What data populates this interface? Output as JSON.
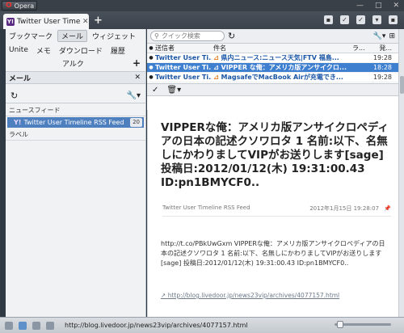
{
  "titlebar": {
    "app_name": "Opera"
  },
  "tab": {
    "title": "Twitter User Timeli...",
    "icon": "Y!"
  },
  "leftpanel": {
    "nav_row1": [
      "ブックマーク",
      "メール",
      "ウィジェット"
    ],
    "nav_row2": [
      "Unite",
      "メモ",
      "ダウンロード",
      "履歴"
    ],
    "nav_row3": "アルク",
    "header": "メール",
    "section_feeds": "ニュースフィード",
    "feed_item": {
      "label": "Twitter User Timeline RSS Feed",
      "count": "20"
    },
    "section_labels": "ラベル"
  },
  "search": {
    "placeholder": "クイック検索"
  },
  "list": {
    "headers": {
      "from": "送信者",
      "subject": "件名",
      "label": "ラ...",
      "time": "発..."
    },
    "rows": [
      {
        "from": "Twitter User Ti...",
        "subject": "県内ニュース:ニュース天気|FTV 福島...",
        "time": "19:28"
      },
      {
        "from": "Twitter User Ti...",
        "subject": "VIPPER な俺：アメリカ版アンサイクロ...",
        "time": "18:28"
      },
      {
        "from": "Twitter User Ti...",
        "subject": "MagsafeでMacBook Airが充電でき...",
        "time": "19:28"
      }
    ]
  },
  "article": {
    "title": "VIPPERな俺：アメリカ版アンサイクロペディアの日本の記述クソワロタ 1 名前:以下、名無しにかわりましてVIPがお送りします[sage] 投稿日:2012/01/12(木) 19:31:00.43 ID:pn1BMYCF0..",
    "source": "Twitter User Timeline RSS Feed",
    "date": "2012年1月15日 19:28:07",
    "body": "http://t.co/PBkUwGxm VIPPERな俺：アメリカ版アンサイクロペディアの日本の記述クソワロタ 1 名前:以下、名無しにかわりましてVIPがお送りします[sage] 投稿日:2012/01/12(木) 19:31:00.43 ID:pn1BMYCF0..",
    "link": "http://blog.livedoor.jp/news23vip/archives/4077157.html"
  },
  "statusbar": {
    "url": "http://blog.livedoor.jp/news23vip/archives/4077157.html"
  },
  "colors": {
    "accent": "#3e7fd0",
    "selected_feed": "#4e7fbf"
  }
}
